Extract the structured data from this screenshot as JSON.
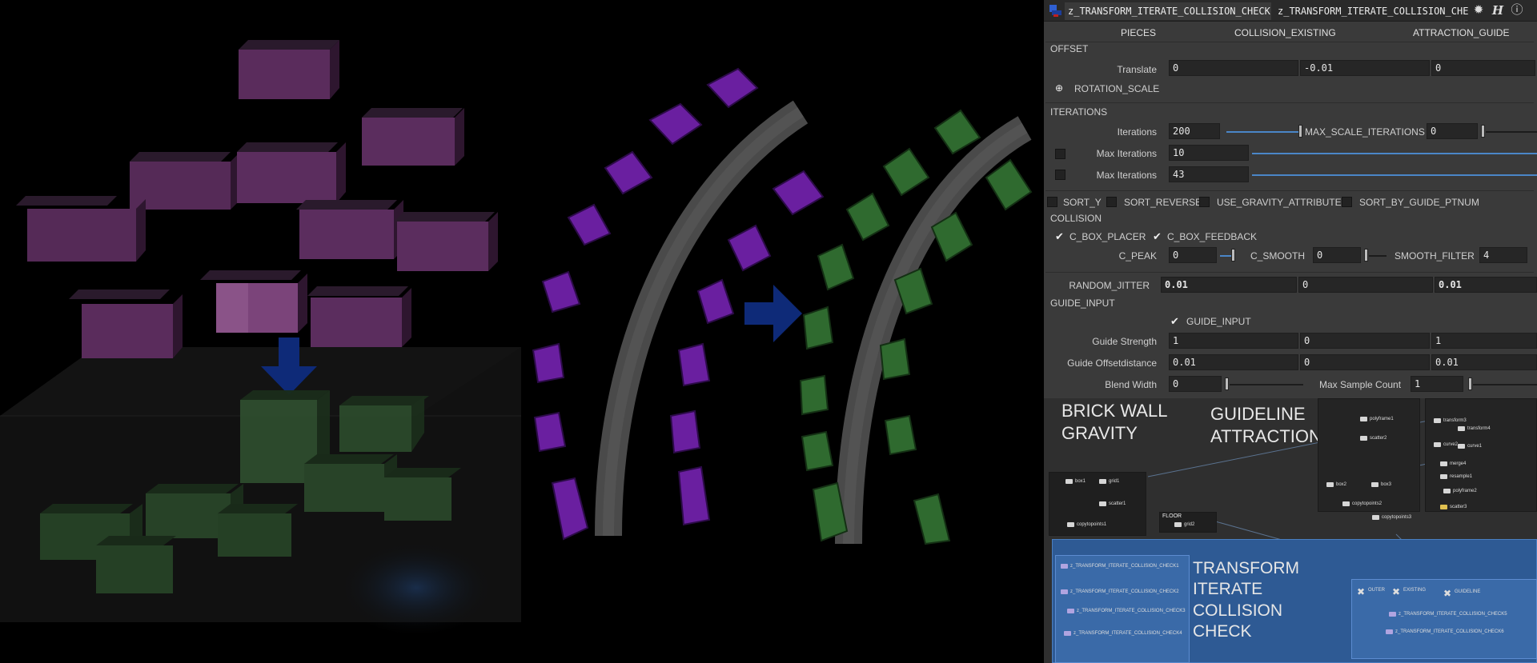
{
  "titlebar": {
    "tab_active": "z_TRANSFORM_ITERATE_COLLISION_CHECK",
    "tab_second": "z_TRANSFORM_ITERATE_COLLISION_CHECK"
  },
  "tabs": [
    "PIECES",
    "COLLISION_EXISTING",
    "ATTRACTION_GUIDE"
  ],
  "offset": {
    "section": "OFFSET",
    "translate_label": "Translate",
    "translate": [
      "0",
      "-0.01",
      "0"
    ],
    "rotation_scale": "ROTATION_SCALE"
  },
  "iterations": {
    "section": "ITERATIONS",
    "iterations_label": "Iterations",
    "iterations_value": "200",
    "max_scale_label": "MAX_SCALE_ITERATIONS",
    "max_scale_value": "0",
    "max_iter_1_label": "Max Iterations",
    "max_iter_1_value": "10",
    "max_iter_2_label": "Max Iterations",
    "max_iter_2_value": "43"
  },
  "sort": {
    "sort_y": "SORT_Y",
    "sort_reverse": "SORT_REVERSE",
    "use_gravity": "USE_GRAVITY_ATTRIBUTE",
    "sort_by_guide": "SORT_BY_GUIDE_PTNUM"
  },
  "collision": {
    "section": "COLLISION",
    "c_box_placer": "C_BOX_PLACER",
    "c_box_feedback": "C_BOX_FEEDBACK",
    "c_peak_label": "C_PEAK",
    "c_peak_value": "0",
    "c_smooth_label": "C_SMOOTH",
    "c_smooth_value": "0",
    "smooth_filter_label": "SMOOTH_FILTER",
    "smooth_filter_value": "4"
  },
  "random_jitter": {
    "label": "RANDOM_JITTER",
    "values": [
      "0.01",
      "0",
      "0.01"
    ]
  },
  "guide_input": {
    "section": "GUIDE_INPUT",
    "toggle_label": "GUIDE_INPUT",
    "strength_label": "Guide Strength",
    "strength": [
      "1",
      "0",
      "1"
    ],
    "offset_label": "Guide Offsetdistance",
    "offset": [
      "0.01",
      "0",
      "0.01"
    ],
    "blend_label": "Blend Width",
    "blend_value": "0",
    "max_sample_label": "Max Sample Count",
    "max_sample_value": "1"
  },
  "network": {
    "sticky_brick": "BRICK WALL\nGRAVITY",
    "sticky_guideline": "GUIDELINE\nATTRACTION",
    "sticky_transform": "TRANSFORM\nITERATE\nCOLLISION\nCHECK",
    "brick_nodes": [
      "box1",
      "grid1",
      "scatter1",
      "copytopoints1"
    ],
    "floor_label": "FLOOR",
    "floor_node": "grid2",
    "guide_nodes_left": [
      "polyframe1",
      "scatter2",
      "box2",
      "box3",
      "copytopoints2",
      "copytopoints3"
    ],
    "guide_nodes_right": [
      "transform3",
      "transform4",
      "curve2",
      "curve1",
      "merge4",
      "resample1",
      "polyframe2",
      "scatter3"
    ],
    "tic_nodes": [
      "z_TRANSFORM_ITERATE_COLLISION_CHECK1",
      "z_TRANSFORM_ITERATE_COLLISION_CHECK2",
      "z_TRANSFORM_ITERATE_COLLISION_CHECK3",
      "z_TRANSFORM_ITERATE_COLLISION_CHECK4"
    ],
    "right_group": [
      "OUTER",
      "EXISTING",
      "GUIDELINE"
    ],
    "right_tic_nodes": [
      "z_TRANSFORM_ITERATE_COLLISION_CHECK5",
      "z_TRANSFORM_ITERATE_COLLISION_CHECK6"
    ]
  },
  "colors": {
    "brick_purple": "#5a2c5c",
    "brick_green": "#2c4a2c",
    "guide_purple": "#6a1fa0",
    "guide_green": "#2f6a2f",
    "arrow_blue": "#0e2a78",
    "network_selection": "#3a6aa8"
  }
}
